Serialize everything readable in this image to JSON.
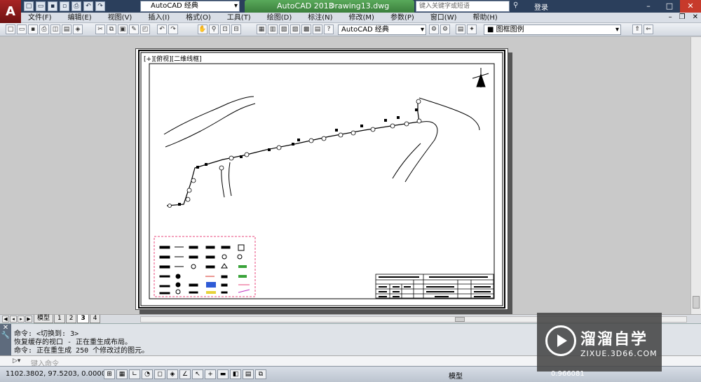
{
  "app": {
    "logo_letter": "A",
    "workspace": "AutoCAD 经典",
    "title_app": "AutoCAD 2013",
    "title_file": "Drawing13.dwg",
    "search_placeholder": "键入关键字或短语",
    "login": "登录"
  },
  "menu": [
    "文件(F)",
    "编辑(E)",
    "视图(V)",
    "插入(I)",
    "格式(O)",
    "工具(T)",
    "绘图(D)",
    "标注(N)",
    "修改(M)",
    "参数(P)",
    "窗口(W)",
    "帮助(H)"
  ],
  "toolbar": {
    "workspace_select": "AutoCAD 经典",
    "layer_select": "图框图例"
  },
  "viewport": {
    "label": "[+][俯视][二维线框]"
  },
  "layout_tabs": [
    "模型",
    "1",
    "2",
    "3",
    "4"
  ],
  "active_tab": "3",
  "command": {
    "history": [
      "命令:  <切换到: 3>",
      "恢复缓存的视口 - 正在重生成布局。",
      "命令: 正在重生成 250 个修改过的图元。"
    ],
    "placeholder": "键入命令"
  },
  "status": {
    "coords": "1102.3802,  97.5203,  0.0000",
    "space": "模型",
    "scale": "0.966081"
  },
  "watermark": {
    "title": "溜溜自学",
    "url": "ZIXUE.3D66.COM"
  },
  "colors": {
    "title_bar": "#2b3f5c",
    "active_tab": "#4a9a4c",
    "legend_border": "#e8487e"
  }
}
